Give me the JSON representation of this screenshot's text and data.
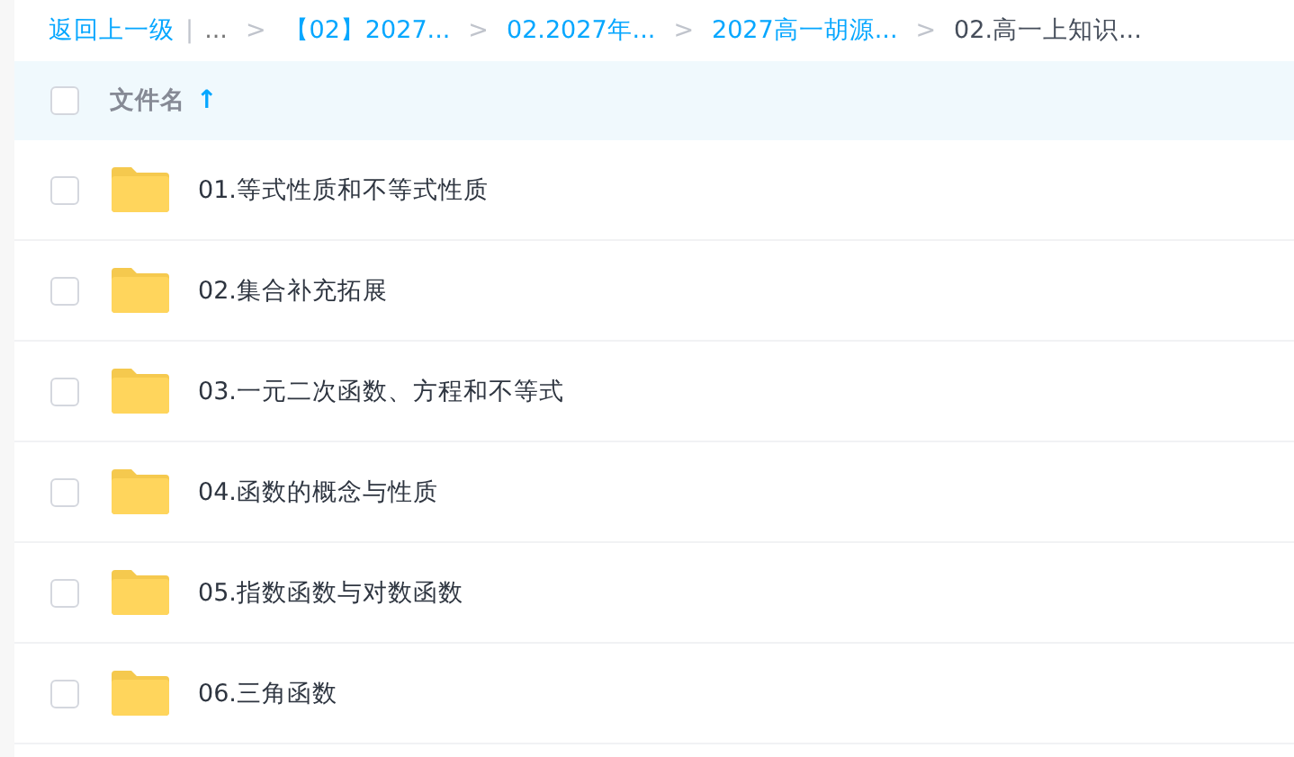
{
  "breadcrumb": {
    "back": "返回上一级",
    "divider": "|",
    "ellipsis": "...",
    "items": [
      {
        "label": "【02】2027...",
        "current": false
      },
      {
        "label": "02.2027年...",
        "current": false
      },
      {
        "label": "2027高一胡源...",
        "current": false
      },
      {
        "label": "02.高一上知识...",
        "current": true
      }
    ],
    "separator": ">"
  },
  "header": {
    "checked": false,
    "column": "文件名",
    "sort_icon": "↑"
  },
  "rows": [
    {
      "name": "01.等式性质和不等式性质",
      "checked": false
    },
    {
      "name": "02.集合补充拓展",
      "checked": false
    },
    {
      "name": "03.一元二次函数、方程和不等式",
      "checked": false
    },
    {
      "name": "04.函数的概念与性质",
      "checked": false
    },
    {
      "name": "05.指数函数与对数函数",
      "checked": false
    },
    {
      "name": "06.三角函数",
      "checked": false
    }
  ]
}
